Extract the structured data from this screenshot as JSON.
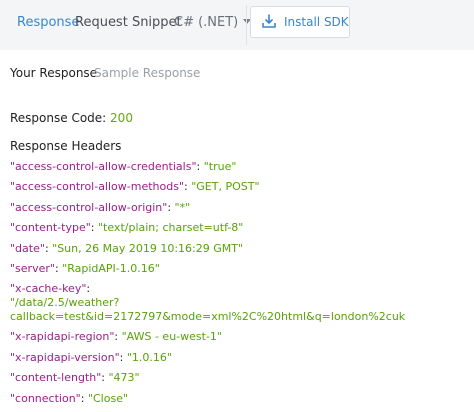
{
  "tabs": {
    "response": "Response",
    "snippet": "Request Snippet"
  },
  "language": "C# (.NET)",
  "install_sdk": "Install SDK",
  "sub_tabs": {
    "your_response": "Your Response",
    "sample_response": "Sample Response"
  },
  "response_code": {
    "label": "Response Code:",
    "value": "200"
  },
  "headers_title": "Response Headers",
  "headers": [
    {
      "key": "\"access-control-allow-credentials\"",
      "value": "\"true\""
    },
    {
      "key": "\"access-control-allow-methods\"",
      "value": "\"GET, POST\""
    },
    {
      "key": "\"access-control-allow-origin\"",
      "value": "\"*\""
    },
    {
      "key": "\"content-type\"",
      "value": "\"text/plain; charset=utf-8\""
    },
    {
      "key": "\"date\"",
      "value": "\"Sun, 26 May 2019 10:16:29 GMT\""
    },
    {
      "key": "\"server\"",
      "value": "\"RapidAPI-1.0.16\""
    },
    {
      "key": "\"x-cache-key\"",
      "value": "\"/data/2.5/weather?callback=test&id=2172797&mode=xml%2C%20html&q=london%2cuk"
    },
    {
      "key": "\"x-rapidapi-region\"",
      "value": "\"AWS - eu-west-1\""
    },
    {
      "key": "\"x-rapidapi-version\"",
      "value": "\"1.0.16\""
    },
    {
      "key": "\"content-length\"",
      "value": "\"473\""
    },
    {
      "key": "\"connection\"",
      "value": "\"Close\""
    }
  ],
  "colors": {
    "accent": "#3a86c9",
    "key": "#9b1e8a",
    "string": "#58a10b"
  },
  "icons": {
    "install": "download-tray-icon",
    "dropdown": "chevron-down-icon"
  }
}
